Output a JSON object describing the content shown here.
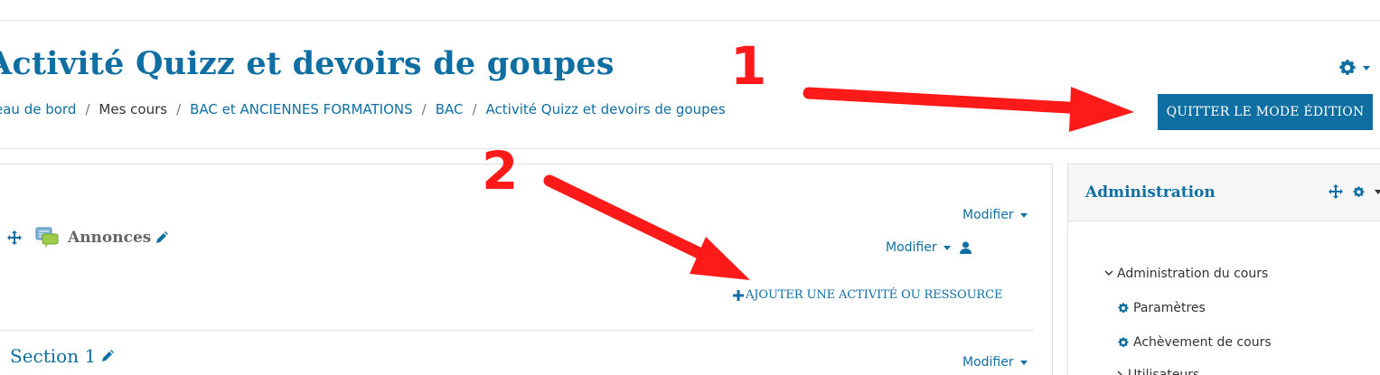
{
  "header": {
    "title": "Activité Quizz et devoirs de goupes",
    "breadcrumb": [
      "Tableau de bord",
      "Mes cours",
      "BAC et ANCIENNES FORMATIONS",
      "BAC",
      "Activité Quizz et devoirs de goupes"
    ],
    "breadcrumb_visible_first": "eau de bord",
    "quit_edit_label": "QUITTER LE MODE ÉDITION"
  },
  "annotations": {
    "step1": "1",
    "step2": "2",
    "color": "#ff1a1a"
  },
  "course": {
    "announcements": {
      "name": "Annonces",
      "edit_label_1": "Modifier",
      "edit_label_2": "Modifier"
    },
    "add_activity_label": "AJOUTER UNE ACTIVITÉ OU RESSOURCE",
    "section1": {
      "title": "Section 1",
      "edit_label": "Modifier"
    }
  },
  "admin": {
    "title": "Administration",
    "items": [
      {
        "label": "Administration du cours",
        "icon": "chevron-down-icon"
      },
      {
        "label": "Paramètres",
        "icon": "gear-icon"
      },
      {
        "label": "Achèvement de cours",
        "icon": "gear-icon"
      },
      {
        "label": "Utilisateurs",
        "icon": "chevron-right-icon"
      }
    ]
  },
  "colors": {
    "accent": "#0f6fa3",
    "border": "#dedede"
  }
}
